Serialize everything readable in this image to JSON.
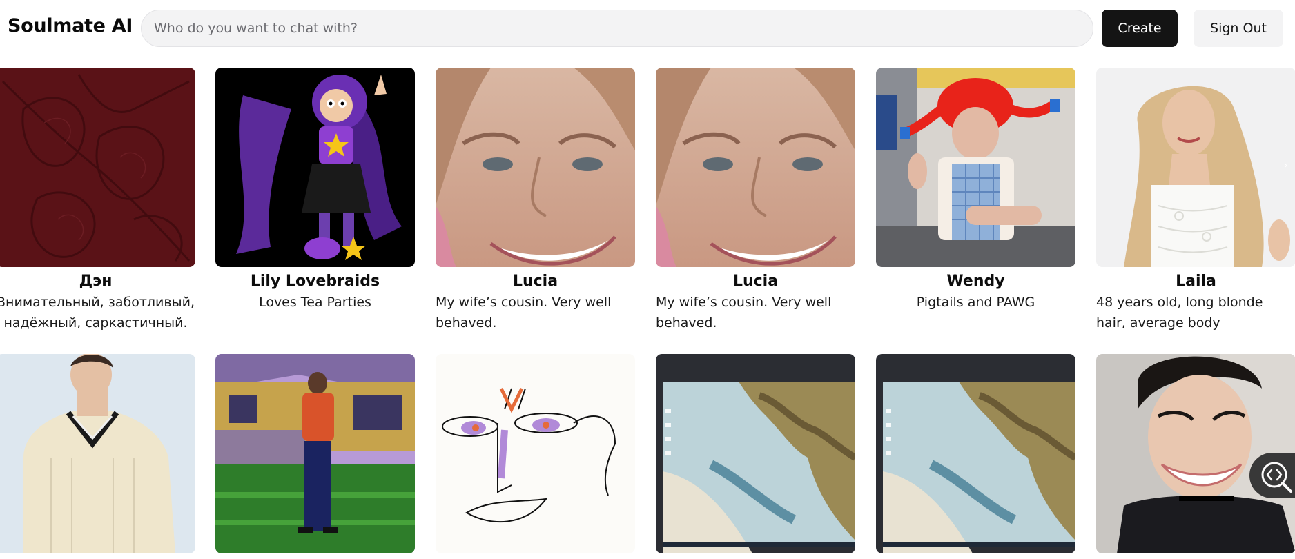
{
  "app": {
    "title": "Soulmate AI"
  },
  "search": {
    "placeholder": "Who do you want to chat with?",
    "value": ""
  },
  "actions": {
    "create_label": "Create",
    "signout_label": "Sign Out"
  },
  "colors": {
    "primary": "#141414",
    "surface": "#f3f3f4",
    "text": "#111111"
  },
  "characters": [
    {
      "name": "Дэн",
      "description": "Внимательный, заботливый, надёжный, саркастичный.",
      "image": "dark-red-floral-texture"
    },
    {
      "name": "Lily Lovebraids",
      "description": "Loves Tea Parties",
      "image": "purple-cartoon-girl"
    },
    {
      "name": "Lucia",
      "description": "My wife’s cousin. Very well behaved.",
      "image": "smiling-woman-face"
    },
    {
      "name": "Lucia",
      "description": "My wife’s cousin. Very well behaved.",
      "image": "smiling-woman-face"
    },
    {
      "name": "Wendy",
      "description": "Pigtails and PAWG",
      "image": "red-pigtails-woman"
    },
    {
      "name": "Laila",
      "description": "48 years old, long blonde hair, average body",
      "image": "blonde-woman"
    }
  ],
  "row2": [
    {
      "image": "man-cream-sweater"
    },
    {
      "image": "woman-outdoor-lawn"
    },
    {
      "image": "face-sketch-drawing"
    },
    {
      "image": "coastline-on-monitor"
    },
    {
      "image": "coastline-on-monitor"
    },
    {
      "image": "smiling-young-man"
    }
  ],
  "icons": {
    "next": "chevron-right-icon",
    "zoom": "zoom-code-icon"
  }
}
